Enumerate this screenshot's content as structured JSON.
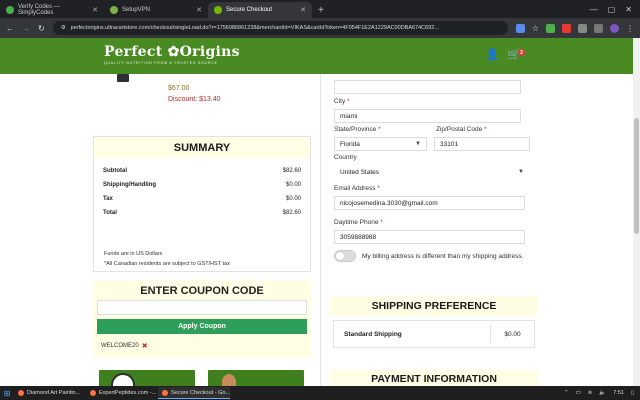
{
  "browser": {
    "tabs": [
      {
        "label": "Verify Codes — SimplyCodes",
        "icon_color": "#4caf50",
        "active": false
      },
      {
        "label": "SetupVPN",
        "icon_color": "#7cb342",
        "active": false
      },
      {
        "label": "Secure Checkout",
        "icon_color": "#76b900",
        "active": true
      }
    ],
    "new_tab": "+",
    "url": "perfectorigins.ultracartstore.com/checkout/singleLoad.do?r=1756986861238&merchantId=VIKAS&cartId​Token=4F954F1E2A1229AC00DBA674C692...",
    "window_controls": [
      "—",
      "▢",
      "✕"
    ]
  },
  "site": {
    "logo_title": "Perfect ✿Origins",
    "logo_tagline": "QUALITY NUTRITION FROM A TRUSTED SOURCE",
    "cart_count": "2"
  },
  "order": {
    "price": "$67.00",
    "discount": "Discount: $13.40"
  },
  "summary": {
    "title": "SUMMARY",
    "rows": [
      {
        "label": "Subtotal",
        "value": "$82.60"
      },
      {
        "label": "Shipping/Handling",
        "value": "$0.00"
      },
      {
        "label": "Tax",
        "value": "$0.00"
      },
      {
        "label": "Total",
        "value": "$82.60"
      }
    ],
    "note1": "Funds are in US Dollars",
    "note2": "*All Canadian residents are subject to GST/HST tax"
  },
  "coupon": {
    "title": "ENTER COUPON CODE",
    "input_value": "",
    "button": "Apply Coupon",
    "applied_code": "WELCOME20",
    "remove_icon": "✖"
  },
  "form": {
    "city_label": "City",
    "city_value": "miami",
    "state_label": "State/Province",
    "state_value": "Florida",
    "zip_label": "Zip/Postal Code",
    "zip_value": "33101",
    "country_label": "Country",
    "country_value": "United States",
    "email_label": "Email Address",
    "email_value": "nicojosemedina.3030@gmail.com",
    "phone_label": "Daytime Phone",
    "phone_value": "3059888988",
    "billing_toggle_label": "My billing address is different than my shipping address.",
    "required_mark": "*"
  },
  "shipping": {
    "title": "SHIPPING PREFERENCE",
    "method": "Standard Shipping",
    "price": "$0.00"
  },
  "payment": {
    "title": "PAYMENT INFORMATION"
  },
  "taskbar": {
    "items": [
      {
        "label": "Diamond Art Paintin...",
        "icon_color": "#ff7043",
        "active": false
      },
      {
        "label": "ExpertPeptides.com -...",
        "icon_color": "#ff7043",
        "active": false
      },
      {
        "label": "Secure Checkout - Go...",
        "icon_color": "#ff7043",
        "active": true
      }
    ],
    "time": "7:51"
  }
}
